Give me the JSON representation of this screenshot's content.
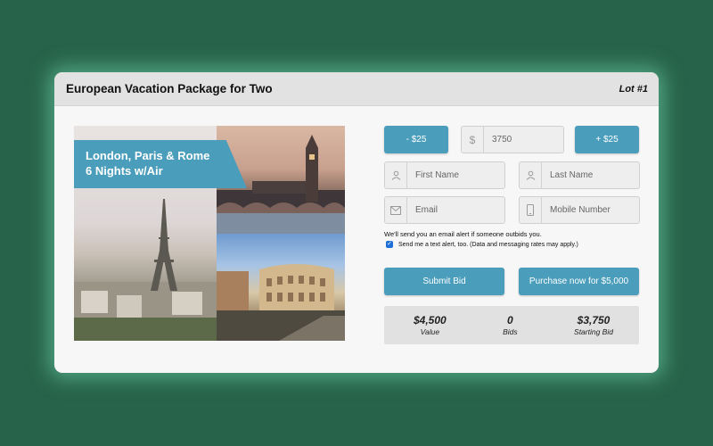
{
  "header": {
    "title": "European Vacation Package for Two",
    "lot": "Lot #1"
  },
  "collage": {
    "banner_line1": "London, Paris & Rome",
    "banner_line2": "6 Nights w/Air"
  },
  "bid": {
    "decrement_label": "- $25",
    "increment_label": "+ $25",
    "currency_symbol": "$",
    "amount_value": "3750"
  },
  "fields": {
    "first_name_placeholder": "First Name",
    "last_name_placeholder": "Last Name",
    "email_placeholder": "Email",
    "mobile_placeholder": "Mobile Number"
  },
  "notice": {
    "email_alert": "We'll send you an email alert if someone outbids you.",
    "text_alert_checked": true,
    "text_alert_label": "Send me a text alert, too. (Data and messaging rates may apply.)"
  },
  "actions": {
    "submit_label": "Submit Bid",
    "purchase_label": "Purchase now for $5,000"
  },
  "stats": [
    {
      "value": "$4,500",
      "label": "Value"
    },
    {
      "value": "0",
      "label": "Bids"
    },
    {
      "value": "$3,750",
      "label": "Starting Bid"
    }
  ],
  "colors": {
    "background": "#27634a",
    "accent": "#4a9dbb",
    "card": "#f7f7f7"
  }
}
